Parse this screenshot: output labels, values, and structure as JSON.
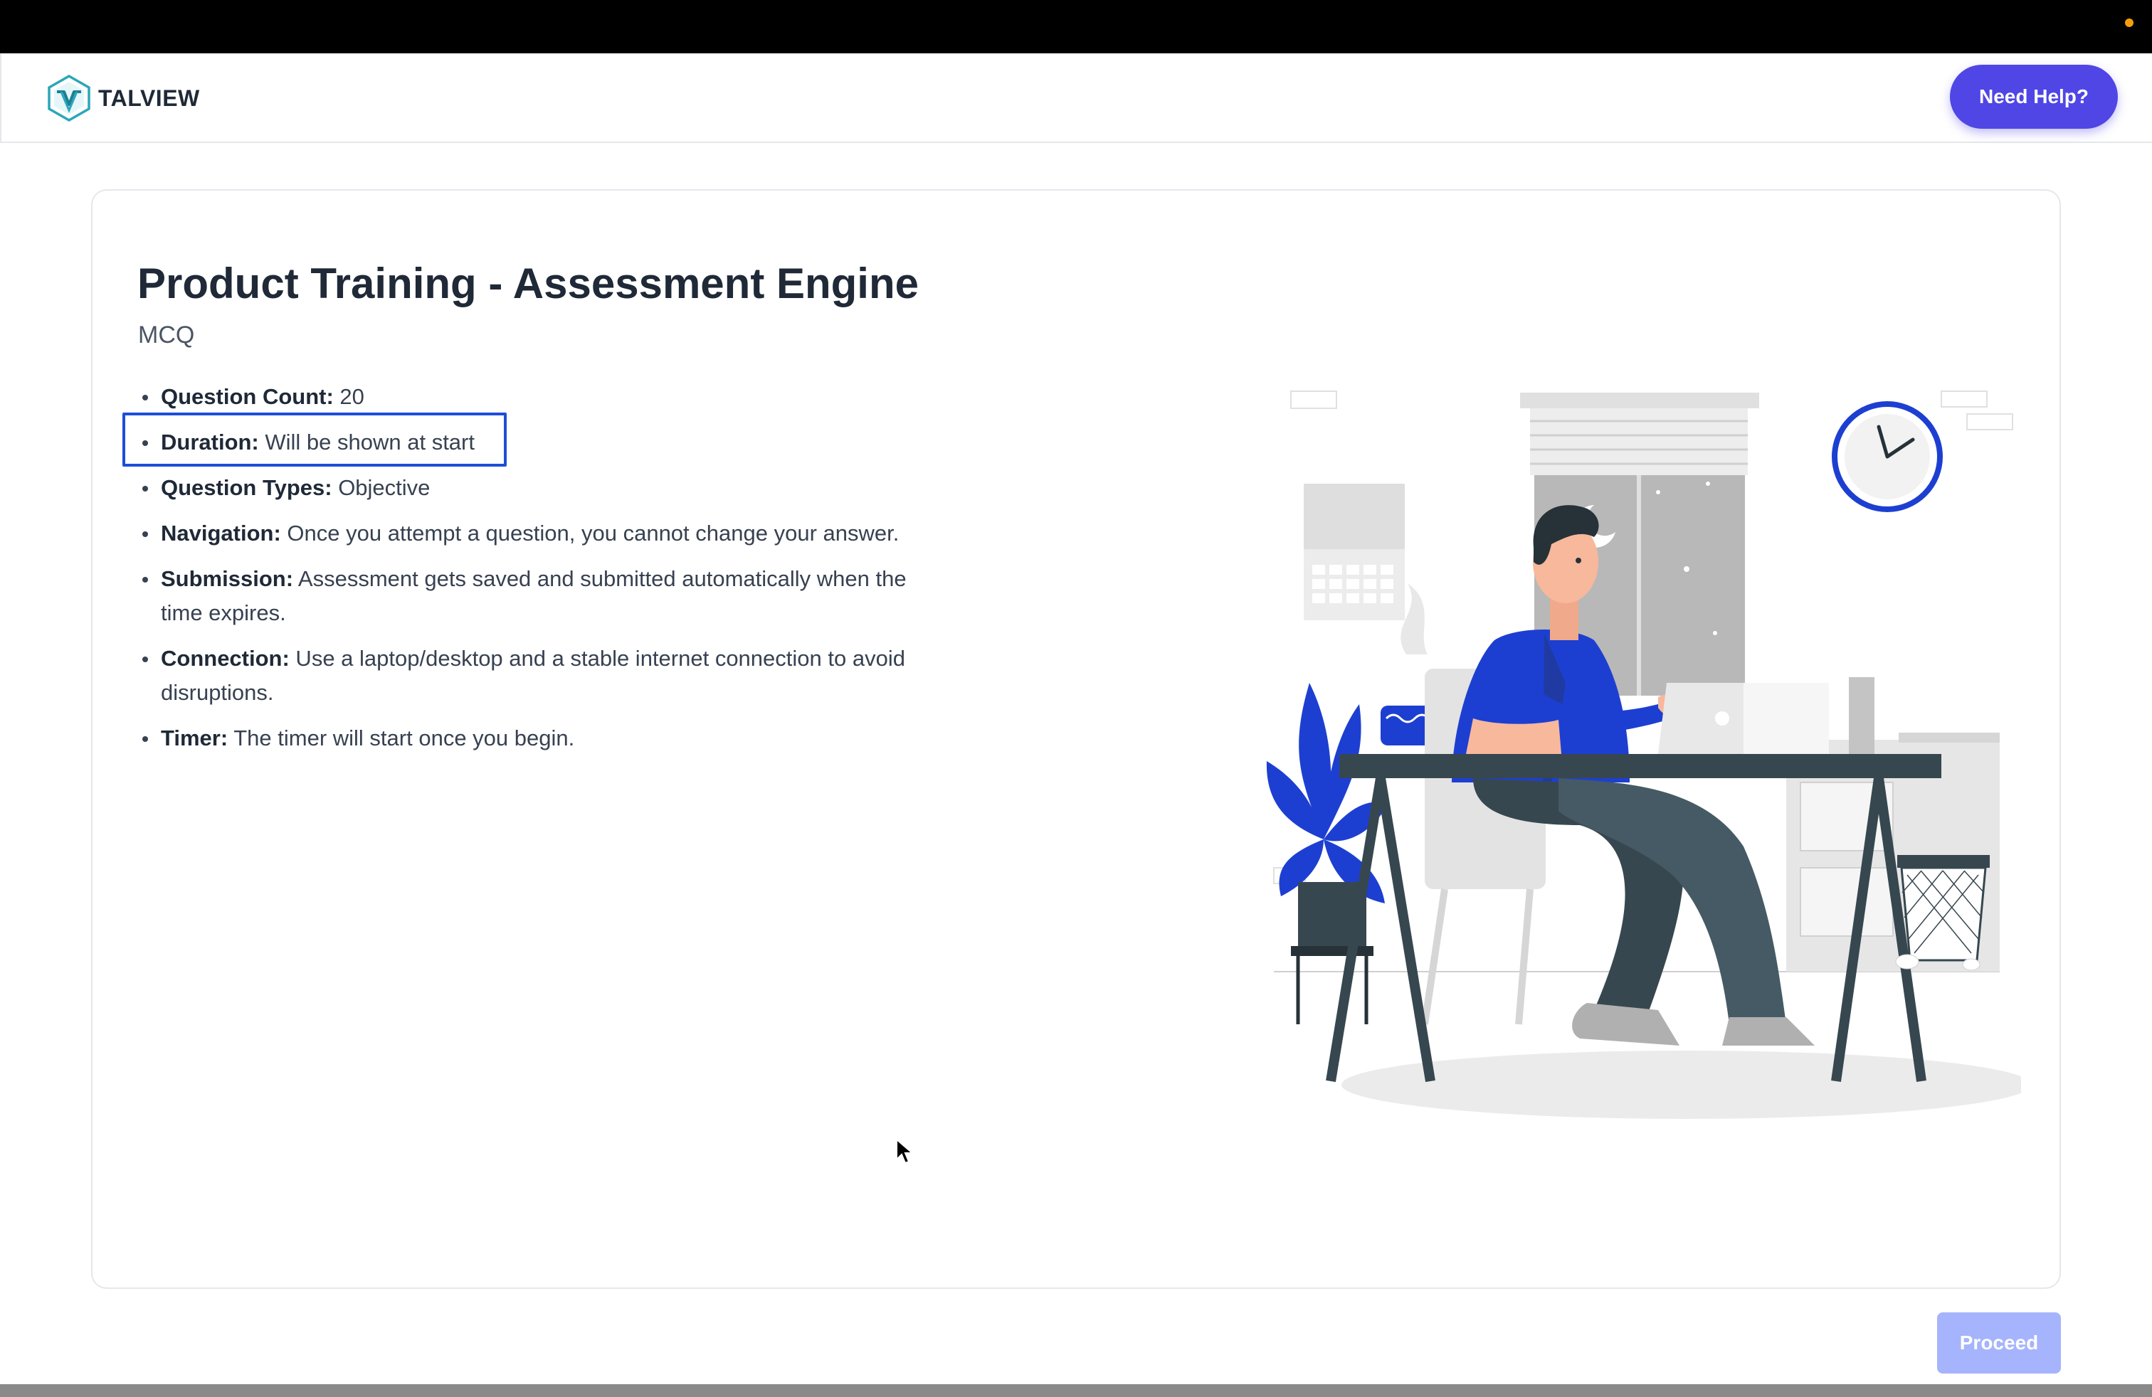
{
  "header": {
    "logo_text": "TALVIEW",
    "help_label": "Need Help?"
  },
  "assessment": {
    "title": "Product Training - Assessment Engine",
    "type": "MCQ",
    "details": [
      {
        "key": "Question Count:",
        "value": " 20"
      },
      {
        "key": "Duration:",
        "value": " Will be shown at start"
      },
      {
        "key": "Question Types:",
        "value": " Objective"
      },
      {
        "key": "Navigation:",
        "value": " Once you attempt a question, you cannot change your answer."
      },
      {
        "key": "Submission:",
        "value": " Assessment gets saved and submitted automatically when the time expires."
      },
      {
        "key": "Connection:",
        "value": " Use a laptop/desktop and a stable internet connection to avoid disruptions."
      },
      {
        "key": "Timer:",
        "value": " The timer will start once you begin."
      }
    ]
  },
  "footer": {
    "proceed_label": "Proceed"
  },
  "colors": {
    "accent": "#4f46e5",
    "proceed_disabled": "#a5b4fc",
    "highlight": "#1d4ed8",
    "illustration_blue": "#1d3fd1"
  },
  "icons": {
    "logo": "talview-hexagon-logo",
    "cursor": "mouse-pointer-icon"
  }
}
